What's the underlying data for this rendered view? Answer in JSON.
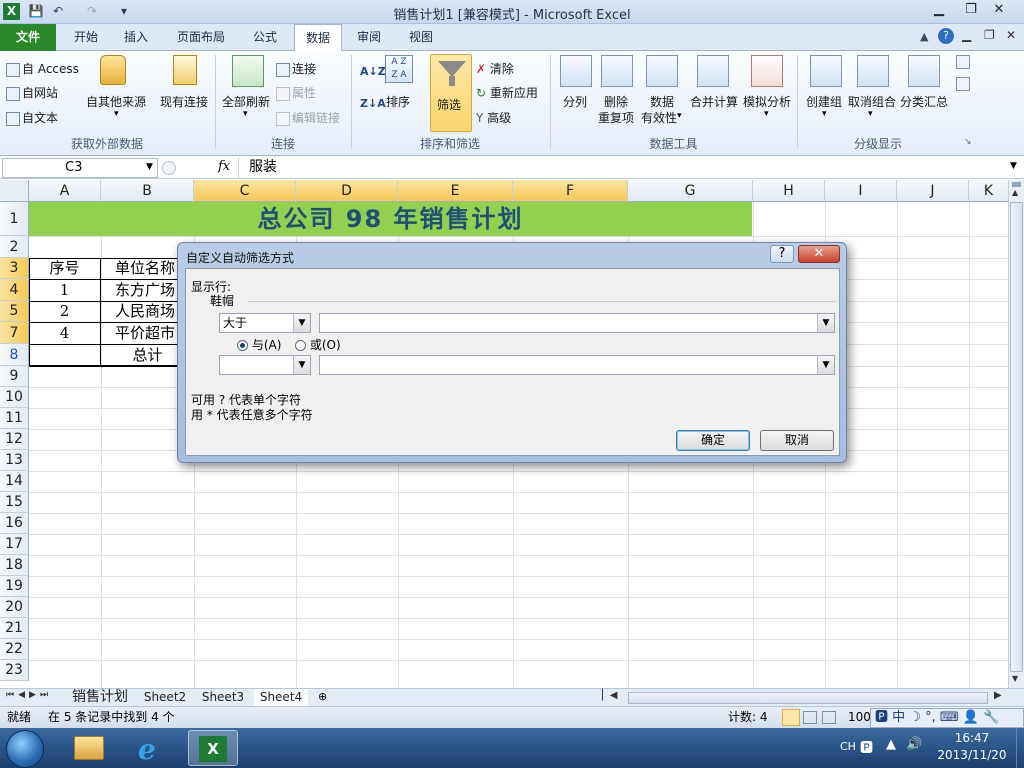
{
  "window": {
    "title": "销售计划1  [兼容模式]  - Microsoft Excel",
    "controls": {
      "minimize": "▁",
      "restore": "❐",
      "close": "✕"
    }
  },
  "quick_access": {
    "save_icon": "save-icon",
    "undo_icon": "undo-icon",
    "redo_icon": "redo-icon"
  },
  "ribbon_tabs": [
    "文件",
    "开始",
    "插入",
    "页面布局",
    "公式",
    "数据",
    "审阅",
    "视图"
  ],
  "active_tab": "数据",
  "ribbon": {
    "external_data": {
      "access": "自 Access",
      "web": "自网站",
      "text": "自文本",
      "other": "自其他来源",
      "existing": "现有连接",
      "label": "获取外部数据"
    },
    "connections": {
      "refresh_all": "全部刷新",
      "connections": "连接",
      "properties": "属性",
      "edit_links": "编辑链接",
      "label": "连接"
    },
    "sort_filter": {
      "sort": "排序",
      "filter": "筛选",
      "clear": "清除",
      "reapply": "重新应用",
      "advanced": "高级",
      "sort_az": "A↓Z",
      "sort_za": "Z↓A",
      "label": "排序和筛选"
    },
    "data_tools": {
      "text_to_columns": "分列",
      "remove_dup_1": "删除",
      "remove_dup_2": "重复项",
      "validation_1": "数据",
      "validation_2": "有效性",
      "consolidate": "合并计算",
      "what_if": "模拟分析",
      "label": "数据工具"
    },
    "outline": {
      "group": "创建组",
      "ungroup": "取消组合",
      "subtotal": "分类汇总",
      "label": "分级显示"
    }
  },
  "formula_bar": {
    "name_box": "C3",
    "fx": "fx",
    "formula": "服装"
  },
  "columns": [
    "A",
    "B",
    "C",
    "D",
    "E",
    "F",
    "G",
    "H",
    "I",
    "J",
    "K"
  ],
  "rows": [
    "1",
    "2",
    "3",
    "4",
    "5",
    "6",
    "7",
    "8",
    "9",
    "10",
    "11",
    "12",
    "13",
    "14",
    "15",
    "16",
    "17",
    "18",
    "19",
    "20",
    "21",
    "22",
    "23"
  ],
  "sheet": {
    "title": "总公司 98 年销售计划",
    "header": {
      "seq": "序号",
      "unit": "单位名称"
    },
    "data_rows": [
      {
        "seq": "1",
        "unit": "东方广场"
      },
      {
        "seq": "2",
        "unit": "人民商场"
      },
      {
        "seq": "4",
        "unit": "平价超市"
      }
    ],
    "total": "总计"
  },
  "sheet_tabs": [
    "销售计划",
    "Sheet2",
    "Sheet3",
    "Sheet4"
  ],
  "active_sheet": "Sheet4",
  "status": {
    "ready": "就绪",
    "filter_msg": "在 5 条记录中找到 4 个",
    "count": "计数: 4",
    "zoom": "100"
  },
  "ime": {
    "lang": "中",
    "lang_code": "CH"
  },
  "taskbar": {
    "time": "16:47",
    "date": "2013/11/20"
  },
  "dialog": {
    "title": "自定义自动筛选方式",
    "help": "?",
    "show_rows": "显示行:",
    "field": "鞋帽",
    "op1": "大于",
    "val1": "",
    "and_label": "与(A)",
    "or_label": "或(O)",
    "op2": "",
    "val2": "",
    "hint1": "可用 ? 代表单个字符",
    "hint2": "用 * 代表任意多个字符",
    "ok": "确定",
    "cancel": "取消"
  }
}
